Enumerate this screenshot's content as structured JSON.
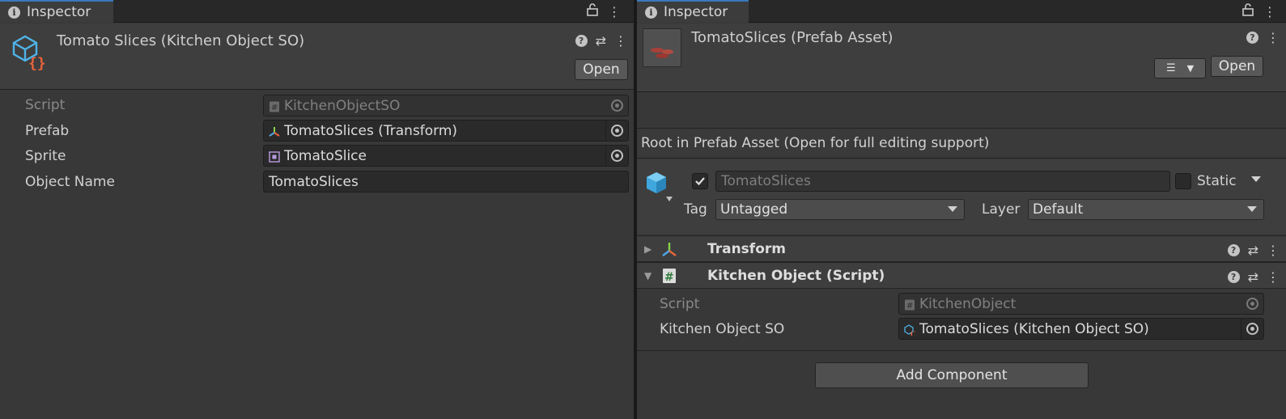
{
  "left_inspector": {
    "tab_label": "Inspector",
    "title": "Tomato Slices (Kitchen Object SO)",
    "open_label": "Open",
    "fields": [
      {
        "label": "Script",
        "value": "KitchenObjectSO",
        "icon": "script-icon",
        "disabled": true
      },
      {
        "label": "Prefab",
        "value": "TomatoSlices (Transform)",
        "icon": "transform-icon",
        "disabled": false
      },
      {
        "label": "Sprite",
        "value": "TomatoSlice",
        "icon": "sprite-icon",
        "disabled": false
      },
      {
        "label": "Object Name",
        "value": "TomatoSlices",
        "disabled": false
      }
    ]
  },
  "right_inspector": {
    "tab_label": "Inspector",
    "title": "TomatoSlices (Prefab Asset)",
    "open_label": "Open",
    "root_notice": "Root in Prefab Asset (Open for full editing support)",
    "gameobject": {
      "name": "TomatoSlices",
      "active": true,
      "static_label": "Static",
      "tag_label": "Tag",
      "tag_value": "Untagged",
      "layer_label": "Layer",
      "layer_value": "Default"
    },
    "components": [
      {
        "title": "Transform",
        "expanded": false,
        "icon": "transform-icon"
      },
      {
        "title": "Kitchen Object (Script)",
        "expanded": true,
        "icon": "script-icon"
      }
    ],
    "kitchen_object_fields": [
      {
        "label": "Script",
        "value": "KitchenObject",
        "icon": "script-icon",
        "disabled": true
      },
      {
        "label": "Kitchen Object SO",
        "value": "TomatoSlices (Kitchen Object SO)",
        "icon": "scriptable-object-icon",
        "disabled": false
      }
    ],
    "add_component_label": "Add Component"
  },
  "colors": {
    "panel_bg": "#383838",
    "header_bg": "#3e3e3e",
    "field_bg": "#2a2a2a",
    "tab_accent": "#3a79bb",
    "so_icon_blue": "#4fb3e8",
    "so_icon_orange": "#e8643c"
  }
}
